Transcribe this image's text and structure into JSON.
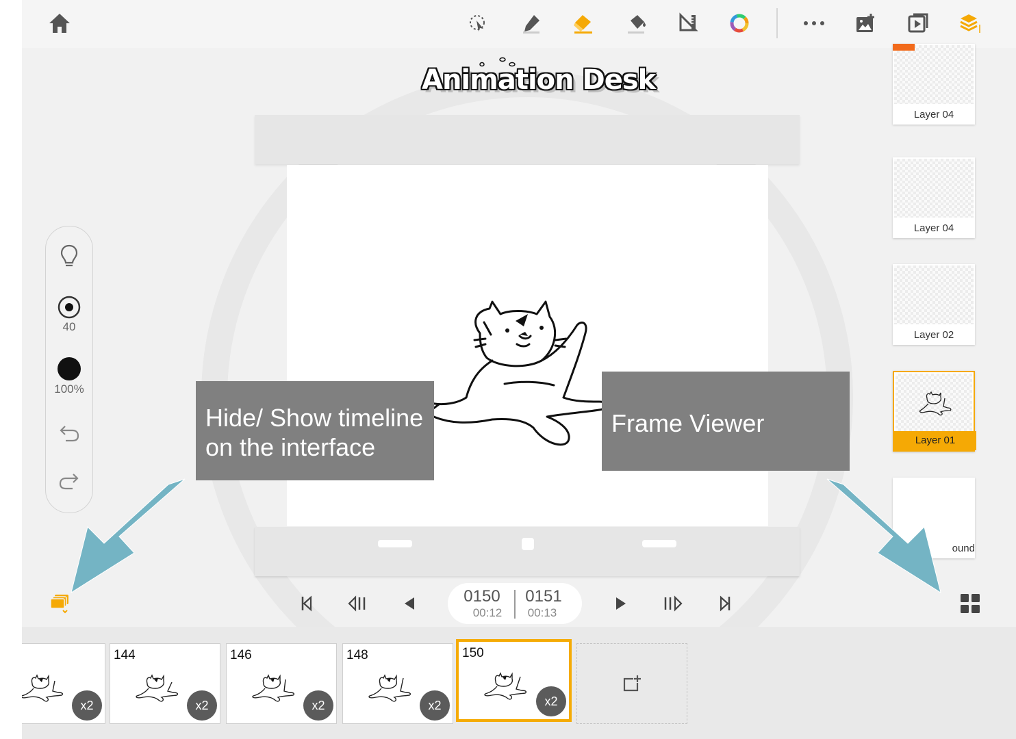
{
  "toolbar": {
    "icons": [
      "home-icon",
      "lasso-select-icon",
      "pen-icon",
      "eraser-icon",
      "paint-bucket-icon",
      "ruler-icon",
      "color-wheel-icon",
      "more-icon",
      "add-image-icon",
      "play-preview-icon",
      "layers-icon"
    ],
    "accent_color": "#f5a905"
  },
  "app": {
    "logo_text": "Animation Desk"
  },
  "tools_panel": {
    "brush_size": "40",
    "opacity": "100%"
  },
  "layers": [
    {
      "label": "Layer 04",
      "pro": true
    },
    {
      "label": "Layer 04",
      "pro": false
    },
    {
      "label": "Layer 02",
      "pro": false
    },
    {
      "label": "Layer 01",
      "pro": false,
      "active": true
    },
    {
      "label": "ound",
      "pro": false
    }
  ],
  "transport": {
    "current_frame": "0150",
    "current_time": "00:12",
    "next_frame": "0151",
    "next_time": "00:13"
  },
  "timeline": {
    "frames": [
      {
        "number": "",
        "badge": "x2"
      },
      {
        "number": "144",
        "badge": "x2"
      },
      {
        "number": "146",
        "badge": "x2"
      },
      {
        "number": "148",
        "badge": "x2"
      },
      {
        "number": "150",
        "badge": "x2",
        "active": true
      }
    ]
  },
  "annotations": {
    "timeline_note": "Hide/ Show timeline on the interface",
    "viewer_note": "Frame Viewer",
    "arrow_color": "#74b4c4"
  }
}
